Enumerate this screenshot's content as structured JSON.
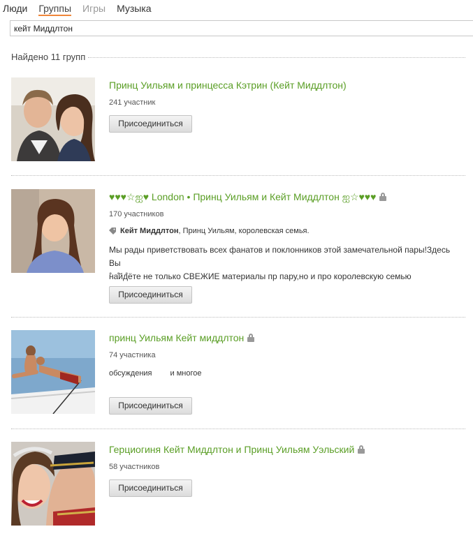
{
  "tabs": [
    "Люди",
    "Группы",
    "Игры",
    "Музыка"
  ],
  "search": {
    "value": "кейт Миддлтон"
  },
  "results_found": "Найдено 11 групп",
  "join_label": "Присоединиться",
  "groups": [
    {
      "title": "Принц Уильям и принцесса Кэтрин (Кейт Миддлтон)",
      "members": "241 участник"
    },
    {
      "title": "♥♥♥☆ஐ♥ London • Принц Уильям и Кейт Миддлтон ஐ☆♥♥♥",
      "members": "170 участников",
      "tags_bold": "Кейт Миддлтон",
      "tags_rest": ", Принц Уильям, королевская семья.",
      "desc_line1": "Мы рады приветствовать всех фанатов и поклонников этой замечательной пары!Здесь Вы",
      "desc_line2": "найдёте не только СВЕЖИЕ материалы пр пару,но и про королевскую семью",
      "more": "• • •"
    },
    {
      "title": "принц Уильям Кейт миддлтон",
      "members": "74 участника",
      "extra1": "обсуждения",
      "extra2": "и многое"
    },
    {
      "title": "Герциогиня Кейт Миддлтон и Принц Уильям Уэльский",
      "members": "58 участников"
    }
  ]
}
